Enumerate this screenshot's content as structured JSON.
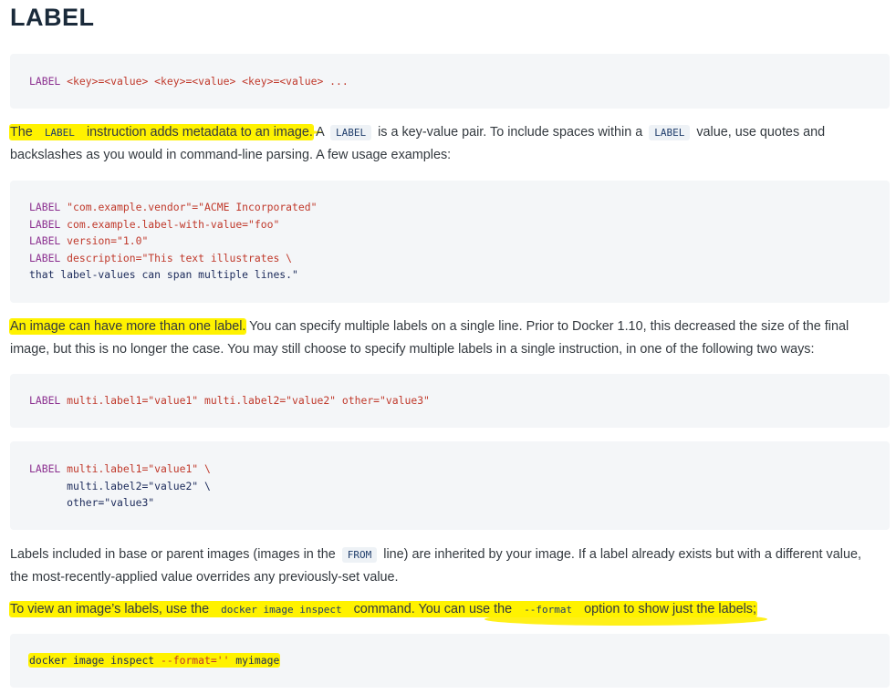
{
  "heading": "LABEL",
  "code_syntax": {
    "kw": "LABEL",
    "rest": " <key>=<value> <key>=<value> <key>=<value> ..."
  },
  "para1": {
    "the": "The",
    "label_code": "LABEL",
    "instruction_text": "instruction adds metadata to an image.",
    "a_text": "A",
    "label_code2": "LABEL",
    "kv_text": "is a key-value pair. To include spaces within a",
    "label_code3": "LABEL",
    "rest1": "value, use quotes and",
    "line2": "backslashes as you would in command-line parsing. A few usage examples:"
  },
  "code_examples": [
    {
      "kw": "LABEL",
      "sp": " ",
      "val": "\"com.example.vendor\"=\"ACME Incorporated\""
    },
    {
      "kw": "LABEL",
      "sp": " ",
      "val": "com.example.label-with-value=\"foo\""
    },
    {
      "kw": "LABEL",
      "sp": " ",
      "val": "version=\"1.0\""
    },
    {
      "kw": "LABEL",
      "sp": " ",
      "val": "description=\"This text illustrates \\"
    }
  ],
  "code_examples_last": "that label-values can span multiple lines.\"",
  "para2": {
    "highlight": "An image can have more than one label.",
    "rest": " You can specify multiple labels on a single line. Prior to Docker 1.10, this decreased the size of the final",
    "line2": "image, but this is no longer the case. You may still choose to specify multiple labels in a single instruction, in one of the following two ways:"
  },
  "code_multi1": {
    "kw": "LABEL",
    "val": " multi.label1=\"value1\" multi.label2=\"value2\" other=\"value3\""
  },
  "code_multi2": {
    "kw": "LABEL",
    "line1_val": " multi.label1=\"value1\" \\",
    "line2": "      multi.label2=\"value2\" \\",
    "line3": "      other=\"value3\""
  },
  "para3": {
    "part1": "Labels included in base or parent images (images in the",
    "from_code": "FROM",
    "part2": "line) are inherited by your image. If a label already exists but with a different value,",
    "line2": "the most-recently-applied value overrides any previously-set value."
  },
  "para4": {
    "part1": "To view an image’s labels, use the",
    "cmd_code": "docker image inspect",
    "part2": "command. You can use the",
    "format_code": "--format",
    "part3": "option to show just the labels;"
  },
  "code_inspect": {
    "cmd": "docker image inspect ",
    "flag": "--format=''",
    "arg": " myimage"
  },
  "colors": {
    "highlight": "#fff200",
    "code_bg": "#f4f6f8",
    "keyword": "#8b2f8f",
    "string": "#c0392b"
  }
}
